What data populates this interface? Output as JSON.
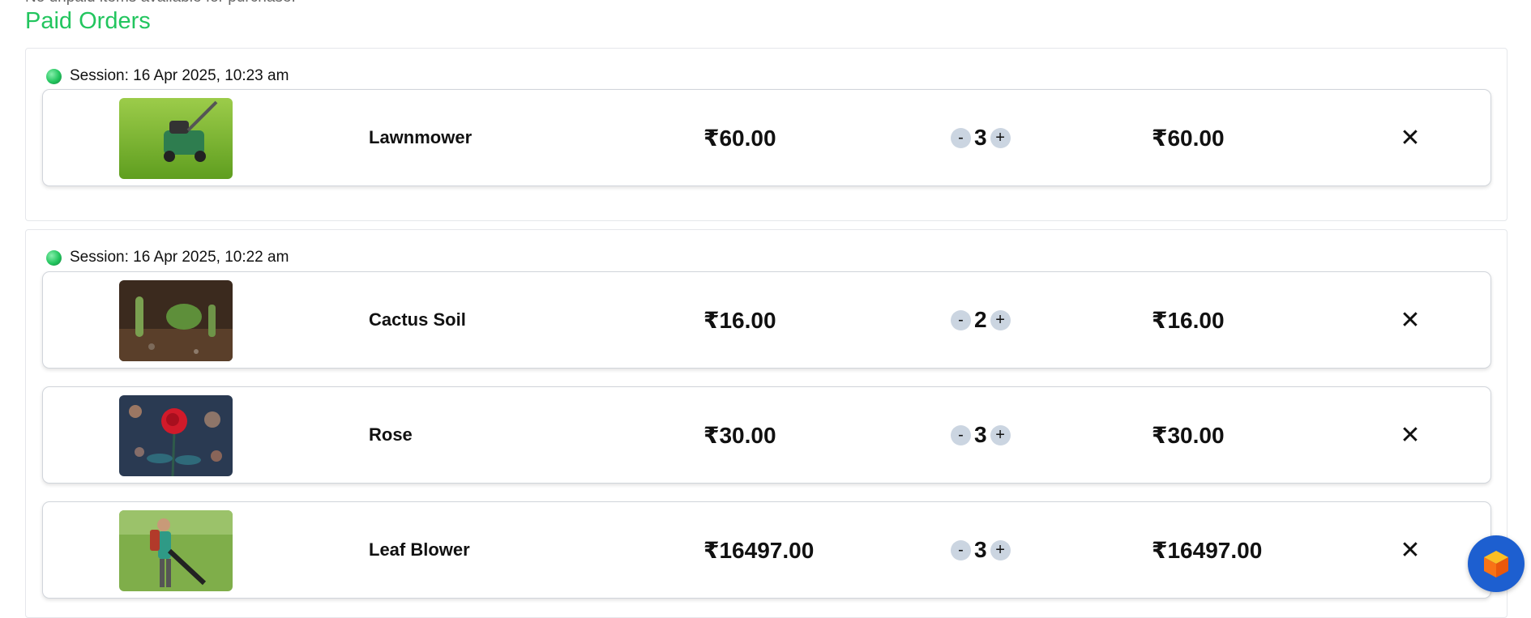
{
  "top_note": "No unpaid items available for purchase.",
  "section_title": "Paid Orders",
  "sessions": [
    {
      "label": "Session: 16 Apr 2025, 10:23 am",
      "items": [
        {
          "name": "Lawnmower",
          "price": "₹60.00",
          "quantity": "3",
          "total": "₹60.00"
        }
      ]
    },
    {
      "label": "Session: 16 Apr 2025, 10:22 am",
      "items": [
        {
          "name": "Cactus Soil",
          "price": "₹16.00",
          "quantity": "2",
          "total": "₹16.00"
        },
        {
          "name": "Rose",
          "price": "₹30.00",
          "quantity": "3",
          "total": "₹30.00"
        },
        {
          "name": "Leaf Blower",
          "price": "₹16497.00",
          "quantity": "3",
          "total": "₹16497.00"
        }
      ]
    }
  ],
  "controls": {
    "decrement": "-",
    "increment": "+",
    "remove": "✕"
  },
  "icons": {
    "session_status": "green-dot-icon",
    "chat_button": "orange-cube-icon"
  },
  "colors": {
    "accent": "#22c55e",
    "fab": "#1d5fd0",
    "qty_button": "#cbd5e1"
  }
}
